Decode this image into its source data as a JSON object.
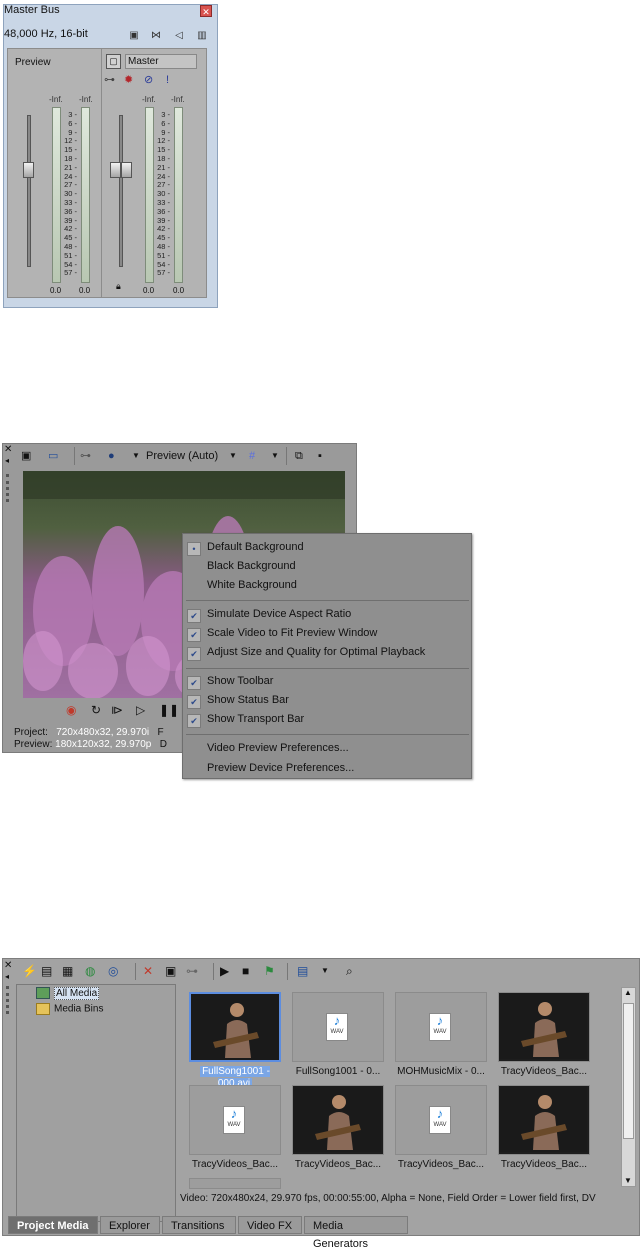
{
  "master_bus": {
    "title": "Master Bus",
    "format": "48,000 Hz, 16-bit",
    "preview_label": "Preview",
    "master_label": "Master",
    "inf_label": "-Inf.",
    "scale": [
      "3",
      "6",
      "9",
      "12",
      "15",
      "18",
      "21",
      "24",
      "27",
      "30",
      "33",
      "36",
      "39",
      "42",
      "45",
      "48",
      "51",
      "54",
      "57"
    ],
    "zero_label": "0.0"
  },
  "video_preview": {
    "quality": "Preview (Auto)",
    "project_label": "Project:",
    "project_value": "720x480x32, 29.970i",
    "preview_label": "Preview:",
    "preview_value": "180x120x32, 29.970p",
    "project_trunc": "F",
    "preview_trunc": "D"
  },
  "context_menu": {
    "items": [
      {
        "label": "Default Background",
        "state": "radio"
      },
      {
        "label": "Black Background",
        "state": "none"
      },
      {
        "label": "White Background",
        "state": "none"
      },
      {
        "label": "Simulate Device Aspect Ratio",
        "state": "check"
      },
      {
        "label": "Scale Video to Fit Preview Window",
        "state": "check"
      },
      {
        "label": "Adjust Size and Quality for Optimal Playback",
        "state": "check"
      },
      {
        "label": "Show Toolbar",
        "state": "check"
      },
      {
        "label": "Show Status Bar",
        "state": "check"
      },
      {
        "label": "Show Transport Bar",
        "state": "check"
      },
      {
        "label": "Video Preview Preferences...",
        "state": "none"
      },
      {
        "label": "Preview Device Preferences...",
        "state": "none"
      }
    ]
  },
  "project_media": {
    "tree": {
      "all_media": "All Media",
      "media_bins": "Media Bins"
    },
    "items": [
      {
        "caption": "FullSong1001 - 000.avi",
        "type": "video",
        "selected": true
      },
      {
        "caption": "FullSong1001 - 0...",
        "type": "wav",
        "selected": false
      },
      {
        "caption": "MOHMusicMix - 0...",
        "type": "wav",
        "selected": false
      },
      {
        "caption": "TracyVideos_Bac...",
        "type": "video",
        "selected": false
      },
      {
        "caption": "TracyVideos_Bac...",
        "type": "wav",
        "selected": false
      },
      {
        "caption": "TracyVideos_Bac...",
        "type": "video",
        "selected": false
      },
      {
        "caption": "TracyVideos_Bac...",
        "type": "wav",
        "selected": false
      },
      {
        "caption": "TracyVideos_Bac...",
        "type": "video",
        "selected": false
      }
    ],
    "wav_label": "WAV",
    "status": "Video: 720x480x24, 29.970 fps, 00:00:55:00, Alpha = None, Field Order = Lower field first, DV",
    "tabs": [
      "Project Media",
      "Explorer",
      "Transitions",
      "Video FX",
      "Media Generators"
    ]
  },
  "colors": {
    "panel": "#9a9a9a",
    "selection": "#7aa6e6",
    "accent_red": "#c0392b"
  }
}
